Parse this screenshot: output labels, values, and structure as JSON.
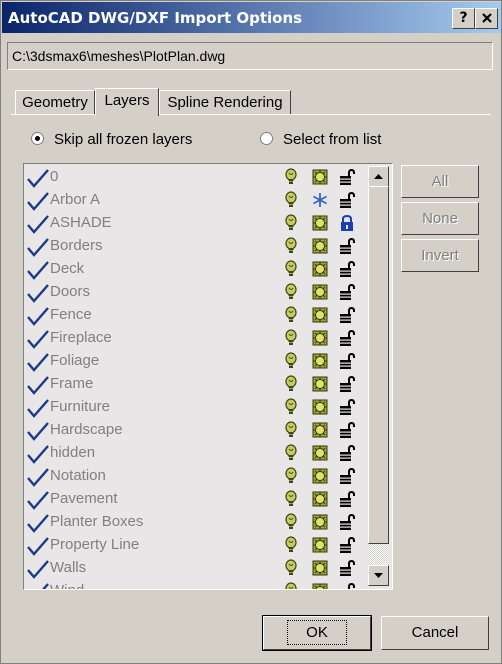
{
  "window": {
    "title": "AutoCAD DWG/DXF Import Options",
    "help_label": "?",
    "close_label": "X"
  },
  "file_path": "C:\\3dsmax6\\meshes\\PlotPlan.dwg",
  "tabs": [
    {
      "label": "Geometry",
      "active": false
    },
    {
      "label": "Layers",
      "active": true
    },
    {
      "label": "Spline Rendering",
      "active": false
    }
  ],
  "options": {
    "skip_frozen_label": "Skip all frozen layers",
    "select_from_list_label": "Select from list",
    "selected": "skip_frozen"
  },
  "layers": [
    {
      "name": "0",
      "frozen": false,
      "locked": false
    },
    {
      "name": "Arbor A",
      "frozen": true,
      "locked": false
    },
    {
      "name": "ASHADE",
      "frozen": false,
      "locked": true
    },
    {
      "name": "Borders",
      "frozen": false,
      "locked": false
    },
    {
      "name": "Deck",
      "frozen": false,
      "locked": false
    },
    {
      "name": "Doors",
      "frozen": false,
      "locked": false
    },
    {
      "name": "Fence",
      "frozen": false,
      "locked": false
    },
    {
      "name": "Fireplace",
      "frozen": false,
      "locked": false
    },
    {
      "name": "Foliage",
      "frozen": false,
      "locked": false
    },
    {
      "name": "Frame",
      "frozen": false,
      "locked": false
    },
    {
      "name": "Furniture",
      "frozen": false,
      "locked": false
    },
    {
      "name": "Hardscape",
      "frozen": false,
      "locked": false
    },
    {
      "name": "hidden",
      "frozen": false,
      "locked": false
    },
    {
      "name": "Notation",
      "frozen": false,
      "locked": false
    },
    {
      "name": "Pavement",
      "frozen": false,
      "locked": false
    },
    {
      "name": "Planter Boxes",
      "frozen": false,
      "locked": false
    },
    {
      "name": "Property Line",
      "frozen": false,
      "locked": false
    },
    {
      "name": "Walls",
      "frozen": false,
      "locked": false
    },
    {
      "name": "Wind",
      "frozen": false,
      "locked": false
    }
  ],
  "side_buttons": {
    "all": "All",
    "none": "None",
    "invert": "Invert"
  },
  "buttons": {
    "ok": "OK",
    "cancel": "Cancel"
  },
  "colors": {
    "title_start": "#0a246a",
    "title_end": "#a6caf0",
    "check": "#1c3a8c",
    "lock_locked": "#1a3fb5"
  }
}
